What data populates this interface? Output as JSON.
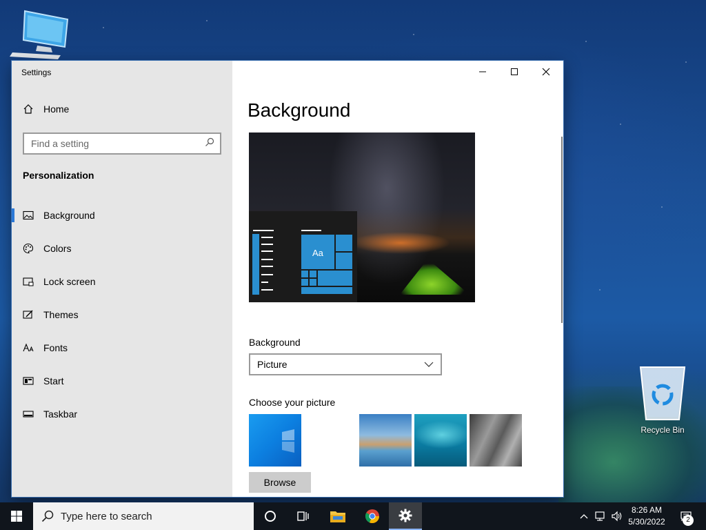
{
  "desktop": {
    "recycle_bin_label": "Recycle Bin"
  },
  "window": {
    "title": "Settings",
    "controls": {
      "minimize": "minimize",
      "maximize": "maximize",
      "close": "close"
    }
  },
  "sidebar": {
    "home_label": "Home",
    "search_placeholder": "Find a setting",
    "section": "Personalization",
    "items": [
      {
        "label": "Background",
        "icon": "picture-icon",
        "active": true
      },
      {
        "label": "Colors",
        "icon": "palette-icon"
      },
      {
        "label": "Lock screen",
        "icon": "lock-screen-icon"
      },
      {
        "label": "Themes",
        "icon": "themes-brush-icon"
      },
      {
        "label": "Fonts",
        "icon": "fonts-icon"
      },
      {
        "label": "Start",
        "icon": "start-icon"
      },
      {
        "label": "Taskbar",
        "icon": "taskbar-icon"
      }
    ]
  },
  "main": {
    "title": "Background",
    "preview_tile_text": "Aa",
    "background_label": "Background",
    "background_value": "Picture",
    "choose_label": "Choose your picture",
    "browse_label": "Browse"
  },
  "taskbar": {
    "search_placeholder": "Type here to search",
    "time": "8:26 AM",
    "date": "5/30/2022",
    "notification_count": "2"
  },
  "colors": {
    "accent": "#2b79d7",
    "tile_blue": "#2a8fd0"
  }
}
